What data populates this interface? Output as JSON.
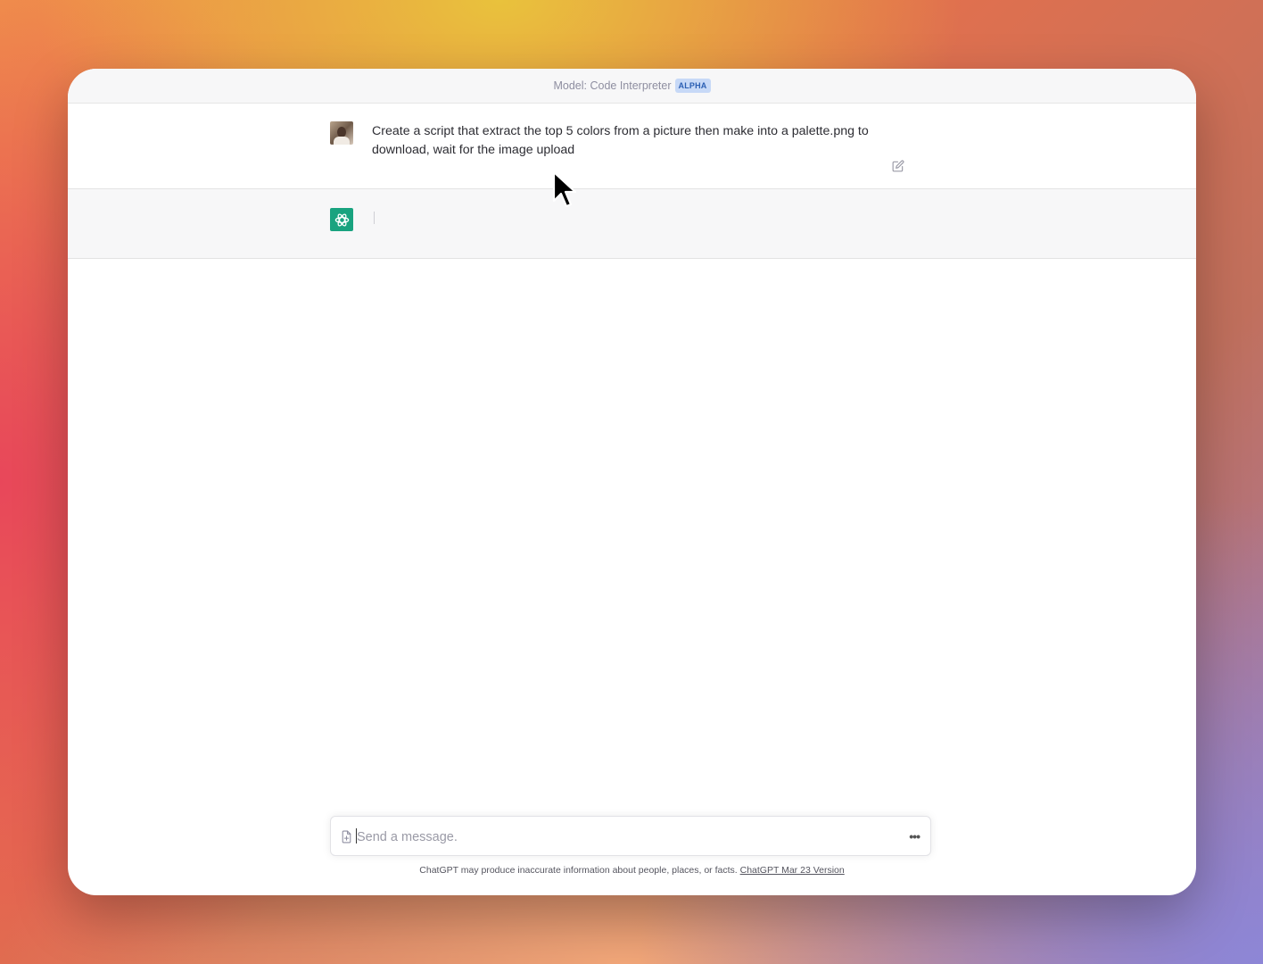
{
  "titlebar": {
    "model_label": "Model: Code Interpreter",
    "badge": "ALPHA"
  },
  "conversation": {
    "user_message": "Create a script that extract the top 5 colors from a picture then make into a palette.png to download, wait for the image upload",
    "assistant_message": ""
  },
  "composer": {
    "placeholder": "Send a message.",
    "value": "",
    "attach_icon": "file-plus-icon",
    "more_icon": "ellipsis-icon"
  },
  "footer": {
    "disclaimer": "ChatGPT may produce inaccurate information about people, places, or facts.",
    "version_link": "ChatGPT Mar 23 Version"
  },
  "colors": {
    "gpt_avatar": "#19a37f",
    "badge_bg": "#c7d9f7",
    "badge_text": "#2b5fb3"
  }
}
